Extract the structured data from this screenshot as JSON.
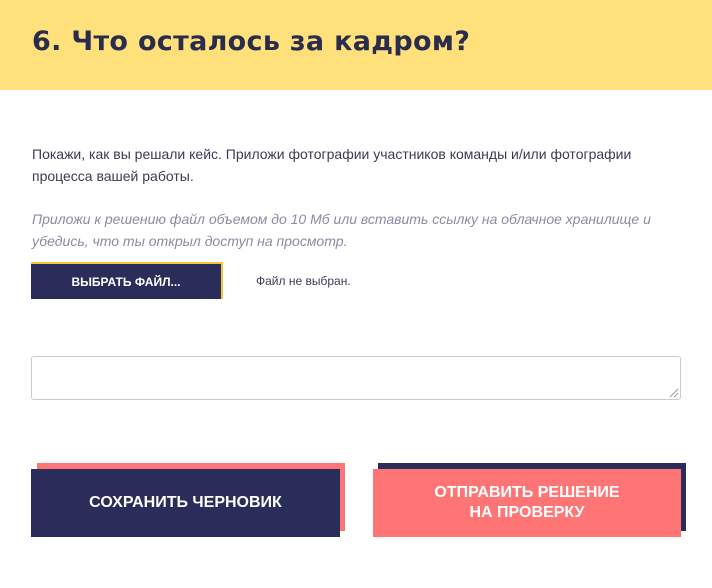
{
  "header": {
    "title": "6. Что осталось за кадром?"
  },
  "description": "Покажи, как вы решали кейс. Приложи фотографии участников команды и/или фотографии процесса вашей работы.",
  "hint": "Приложи к решению файл объемом до 10 Мб или вставить ссылку на облачное хранилище и убедись, что ты открыл доступ на просмотр.",
  "file_upload": {
    "button_label": "ВЫБРАТЬ ФАЙЛ...",
    "status": "Файл не выбран."
  },
  "answer_field": {
    "value": "",
    "placeholder": ""
  },
  "actions": {
    "save_label": "СОХРАНИТЬ ЧЕРНОВИК",
    "submit_line1": "ОТПРАВИТЬ РЕШЕНИЕ",
    "submit_line2": "НА ПРОВЕРКУ"
  },
  "colors": {
    "header_bg": "#ffe07a",
    "navy": "#2a2c5a",
    "coral": "#ff7575",
    "accent_yellow": "#f5c63c"
  }
}
